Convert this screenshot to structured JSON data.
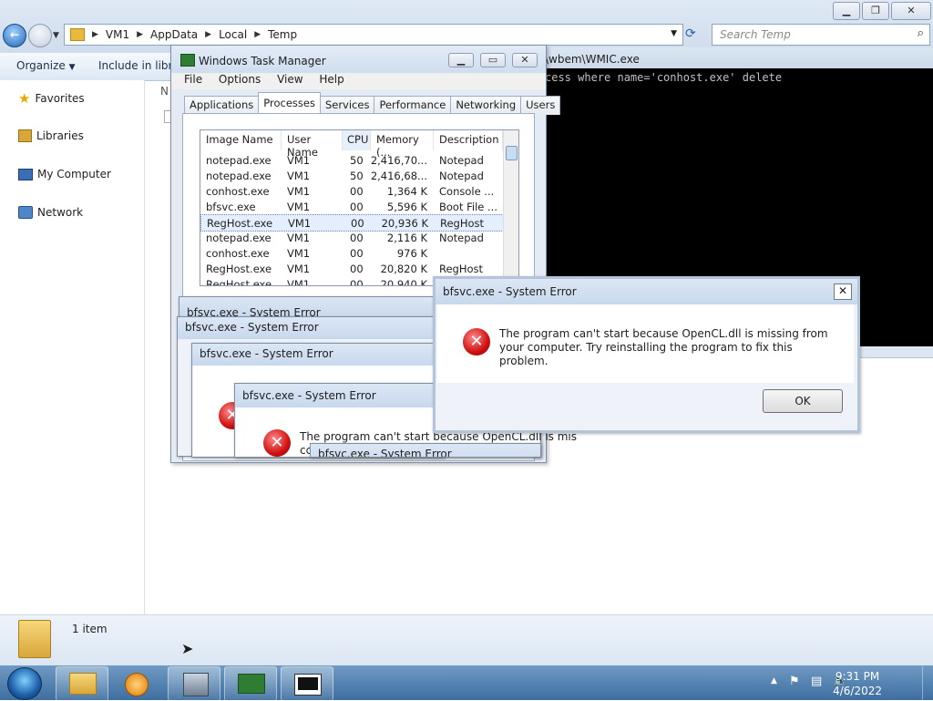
{
  "explorer": {
    "breadcrumb": [
      "VM1",
      "AppData",
      "Local",
      "Temp"
    ],
    "search_placeholder": "Search Temp",
    "toolbar": {
      "organize": "Organize",
      "include": "Include in libra"
    },
    "nav": [
      "Favorites",
      "Libraries",
      "My Computer",
      "Network"
    ],
    "name_col_fragment": "N",
    "status_count": "1 item"
  },
  "console": {
    "title": "\\wbem\\WMIC.exe",
    "line": "cess where name='conhost.exe' delete"
  },
  "taskmgr": {
    "title": "Windows Task Manager",
    "menu": [
      "File",
      "Options",
      "View",
      "Help"
    ],
    "tabs": [
      "Applications",
      "Processes",
      "Services",
      "Performance",
      "Networking",
      "Users"
    ],
    "active_tab": "Processes",
    "columns": [
      "Image Name",
      "User Name",
      "CPU",
      "Memory (...",
      "Description"
    ],
    "rows": [
      {
        "image": "notepad.exe",
        "user": "VM1",
        "cpu": "50",
        "mem": "2,416,70...",
        "desc": "Notepad"
      },
      {
        "image": "notepad.exe",
        "user": "VM1",
        "cpu": "50",
        "mem": "2,416,68...",
        "desc": "Notepad"
      },
      {
        "image": "conhost.exe",
        "user": "VM1",
        "cpu": "00",
        "mem": "1,364 K",
        "desc": "Console ..."
      },
      {
        "image": "bfsvc.exe",
        "user": "VM1",
        "cpu": "00",
        "mem": "5,596 K",
        "desc": "Boot File ..."
      },
      {
        "image": "RegHost.exe",
        "user": "VM1",
        "cpu": "00",
        "mem": "20,936 K",
        "desc": "RegHost"
      },
      {
        "image": "notepad.exe",
        "user": "VM1",
        "cpu": "00",
        "mem": "2,116 K",
        "desc": "Notepad"
      },
      {
        "image": "conhost.exe",
        "user": "VM1",
        "cpu": "00",
        "mem": "976 K",
        "desc": ""
      },
      {
        "image": "RegHost.exe",
        "user": "VM1",
        "cpu": "00",
        "mem": "20,820 K",
        "desc": "RegHost"
      },
      {
        "image": "RegHost.exe",
        "user": "VM1",
        "cpu": "00",
        "mem": "20,940 K",
        "desc": ""
      }
    ]
  },
  "errors": {
    "title": "bfsvc.exe - System Error",
    "message": "The program can't start because OpenCL.dll is missing from your computer. Try reinstalling the program to fix this problem.",
    "partial_message": "The program can't start because OpenCL.dll is mis",
    "partial_fragment": "cc",
    "ok": "OK"
  },
  "taskbar": {
    "time": "9:31 PM",
    "date": "4/6/2022"
  }
}
